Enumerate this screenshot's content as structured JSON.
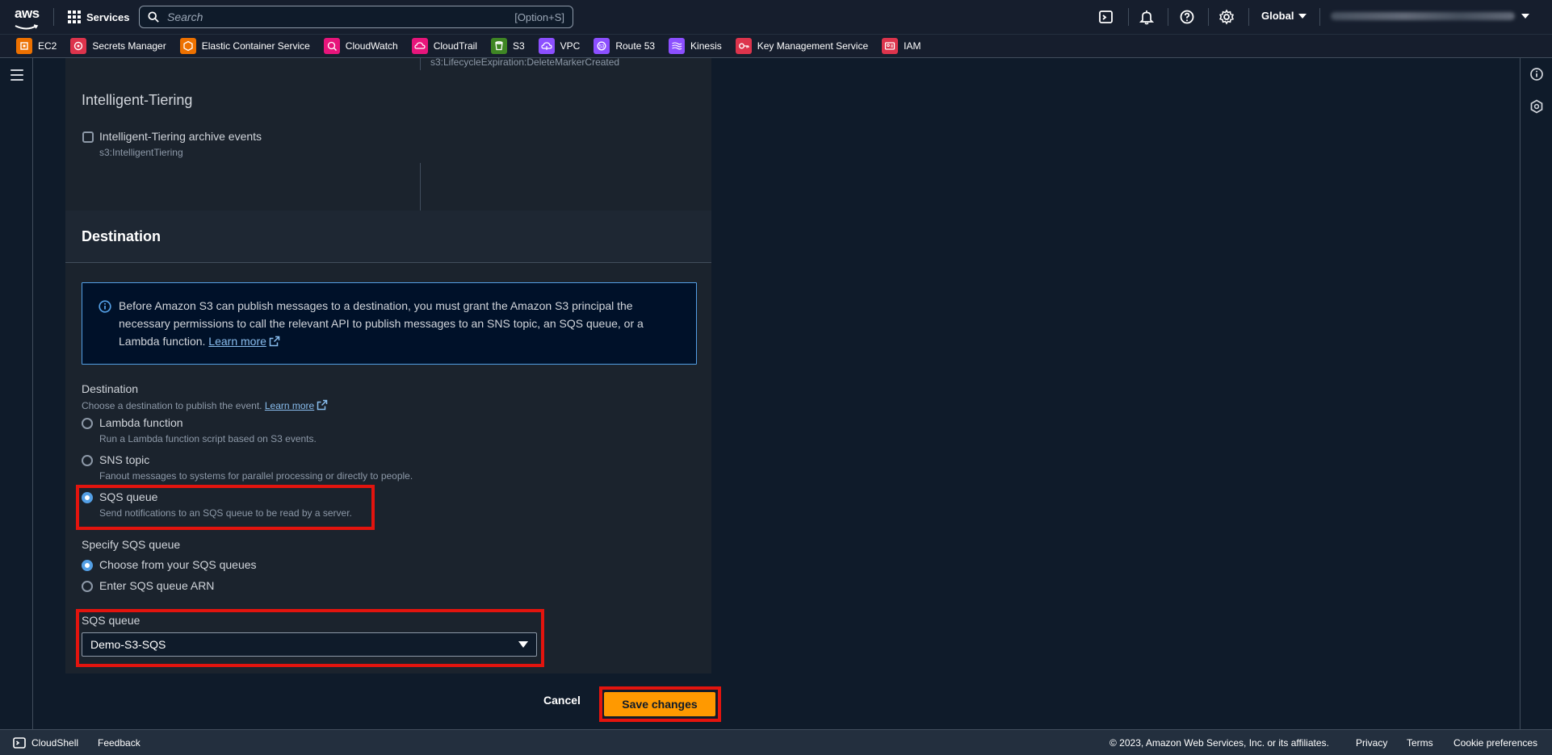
{
  "topnav": {
    "services_label": "Services",
    "search_placeholder": "Search",
    "search_shortcut": "[Option+S]",
    "region_label": "Global",
    "icons": [
      "cloudshell-icon",
      "notifications-icon",
      "help-icon",
      "settings-icon"
    ]
  },
  "favorites": [
    {
      "label": "EC2",
      "color": "#ed7100",
      "icon": "ec2-icon"
    },
    {
      "label": "Secrets Manager",
      "color": "#dd344c",
      "icon": "secrets-manager-icon"
    },
    {
      "label": "Elastic Container Service",
      "color": "#ed7100",
      "icon": "ecs-icon"
    },
    {
      "label": "CloudWatch",
      "color": "#e7157b",
      "icon": "cloudwatch-icon"
    },
    {
      "label": "CloudTrail",
      "color": "#e7157b",
      "icon": "cloudtrail-icon"
    },
    {
      "label": "S3",
      "color": "#3f8624",
      "icon": "s3-icon"
    },
    {
      "label": "VPC",
      "color": "#8c4fff",
      "icon": "vpc-icon"
    },
    {
      "label": "Route 53",
      "color": "#8c4fff",
      "icon": "route53-icon"
    },
    {
      "label": "Kinesis",
      "color": "#8c4fff",
      "icon": "kinesis-icon"
    },
    {
      "label": "Key Management Service",
      "color": "#dd344c",
      "icon": "kms-icon"
    },
    {
      "label": "IAM",
      "color": "#dd344c",
      "icon": "iam-icon"
    }
  ],
  "top_section": {
    "event_code": "s3:LifecycleExpiration:DeleteMarkerCreated",
    "heading": "Intelligent-Tiering",
    "checkbox_label": "Intelligent-Tiering archive events",
    "checkbox_code": "s3:IntelligentTiering"
  },
  "destination": {
    "heading": "Destination",
    "info": {
      "text": "Before Amazon S3 can publish messages to a destination, you must grant the Amazon S3 principal the necessary permissions to call the relevant API to publish messages to an SNS topic, an SQS queue, or a Lambda function.",
      "link": "Learn more"
    },
    "field_label": "Destination",
    "field_description": "Choose a destination to publish the event.",
    "field_link": "Learn more",
    "options": [
      {
        "label": "Lambda function",
        "description": "Run a Lambda function script based on S3 events.",
        "checked": false
      },
      {
        "label": "SNS topic",
        "description": "Fanout messages to systems for parallel processing or directly to people.",
        "checked": false
      },
      {
        "label": "SQS queue",
        "description": "Send notifications to an SQS queue to be read by a server.",
        "checked": true
      }
    ],
    "specify_label": "Specify SQS queue",
    "specify_options": [
      {
        "label": "Choose from your SQS queues",
        "checked": true
      },
      {
        "label": "Enter SQS queue ARN",
        "checked": false
      }
    ],
    "queue_label": "SQS queue",
    "queue_value": "Demo-S3-SQS"
  },
  "actions": {
    "cancel": "Cancel",
    "save": "Save changes"
  },
  "footer": {
    "cloudshell": "CloudShell",
    "feedback": "Feedback",
    "copyright": "© 2023, Amazon Web Services, Inc. or its affiliates.",
    "privacy": "Privacy",
    "terms": "Terms",
    "cookie": "Cookie preferences"
  },
  "colors": {
    "accent": "#539fe5",
    "primary_button": "#ff9900",
    "highlight": "#e3140e"
  }
}
